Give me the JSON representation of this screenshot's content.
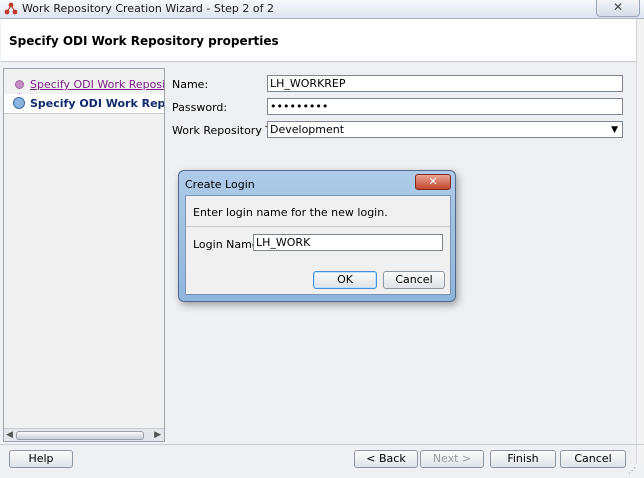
{
  "window": {
    "title": "Work Repository Creation Wizard - Step 2 of 2",
    "close_glyph": "✕"
  },
  "header": {
    "title": "Specify ODI Work Repository properties"
  },
  "nav": {
    "items": [
      {
        "label": "Specify ODI Work Repository conn",
        "state": "visited"
      },
      {
        "label": "Specify ODI Work Repository",
        "state": "current"
      }
    ]
  },
  "form": {
    "name_label": "Name:",
    "name_value": "LH_WORKREP",
    "password_label": "Password:",
    "password_value": "•••••••••",
    "type_label": "Work Repository Type:",
    "type_value": "Development"
  },
  "dialog": {
    "title": "Create Login",
    "close_glyph": "✕",
    "message": "Enter login name for the new login.",
    "login_label": "Login Name:",
    "login_value": "LH_WORK",
    "ok_label": "OK",
    "cancel_label": "Cancel"
  },
  "footer": {
    "help_label": "Help",
    "back_label": "< Back",
    "next_label": "Next >",
    "finish_label": "Finish",
    "cancel_label": "Cancel"
  },
  "colors": {
    "visited_link": "#7b1f86",
    "current_step": "#0f2a6e",
    "dialog_frame": "#8fb5dd",
    "close_button": "#c2452a"
  },
  "icons": {
    "app": "odi-app-icon",
    "step_visited": "step-dot-icon",
    "step_current": "step-current-icon"
  }
}
